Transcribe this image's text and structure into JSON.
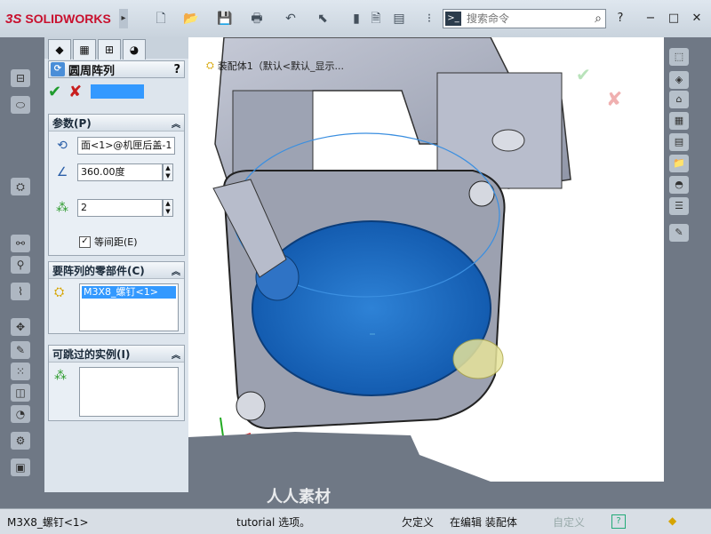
{
  "app": {
    "brand": "SOLIDWORKS",
    "brand_prefix": "3S"
  },
  "toolbar": {
    "icons": [
      "new-icon",
      "open-icon",
      "save-icon",
      "print-icon",
      "undo-icon",
      "select-icon",
      "rebuild-icon",
      "file-properties-icon",
      "options-icon"
    ],
    "search_prompt_icon": ">_",
    "search_placeholder": "搜索命令",
    "help": "?",
    "window_buttons": [
      "−",
      "□",
      "✕"
    ]
  },
  "document_title": "装配体1（默认<默认_显示...",
  "property_manager": {
    "feature_title": "圆周阵列",
    "help": "?",
    "ok": "✔",
    "cancel": "✘",
    "params": {
      "header": "参数(P)",
      "axis_value": "面<1>@机匣后盖-1",
      "angle_value": "360.00度",
      "instances_value": "2",
      "equal_spacing_label": "等间距(E)",
      "equal_spacing_checked": true
    },
    "components": {
      "header": "要阵列的零部件(C)",
      "items": [
        "M3X8_螺钉<1>"
      ]
    },
    "skip": {
      "header": "可跳过的实例(I)",
      "items": []
    }
  },
  "status": {
    "left": "M3X8_螺钉<1>",
    "hint": "tutorial 选项。",
    "state": "欠定义",
    "mode": "在编辑 装配体",
    "custom": "自定义",
    "help_icon": "?"
  },
  "watermark": "人人素材",
  "colors": {
    "accent": "#3399ff",
    "face_blue": "#1d6fc4",
    "brand_red": "#c8102e"
  }
}
